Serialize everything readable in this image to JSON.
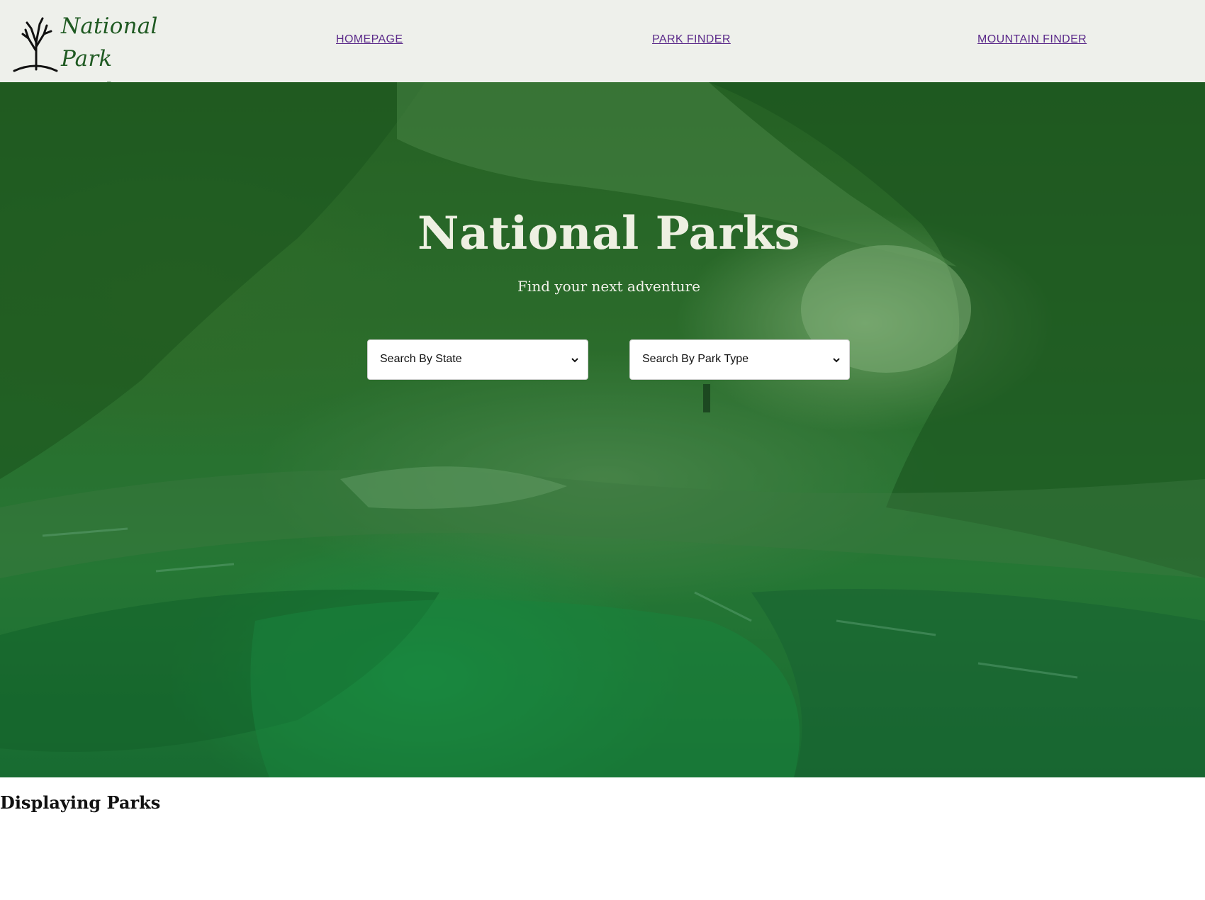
{
  "logo": {
    "line1": "National Park",
    "line2": "Finder",
    "icon": "tree-icon"
  },
  "nav": {
    "items": [
      {
        "label": "HOMEPAGE"
      },
      {
        "label": "PARK FINDER"
      },
      {
        "label": "MOUNTAIN FINDER"
      }
    ]
  },
  "hero": {
    "title": "National Parks",
    "subtitle": "Find your next adventure",
    "background": "slot-canyon-photo",
    "selects": {
      "state": {
        "value": "Search By State",
        "icon": "chevron-down-icon"
      },
      "type": {
        "value": "Search By Park Type",
        "icon": "chevron-down-icon"
      }
    }
  },
  "results": {
    "heading": "Displaying Parks"
  },
  "colors": {
    "nav_bg": "#eef0eb",
    "logo_green": "#1f5a22",
    "link_purple": "#5b2a8a",
    "hero_overlay": "#106e28"
  }
}
